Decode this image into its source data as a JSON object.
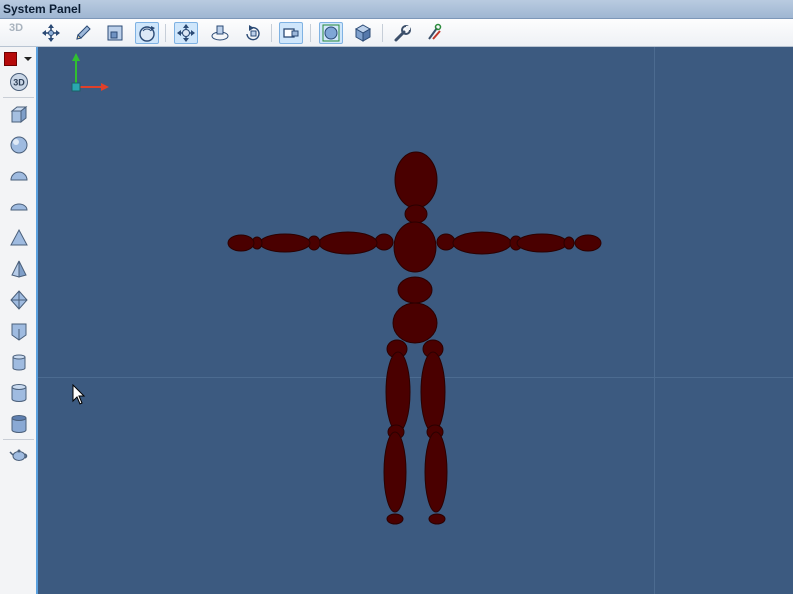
{
  "window": {
    "title": "System Panel"
  },
  "toolbar": {
    "mode_label": "3D",
    "tools": [
      {
        "icon": "move-icon"
      },
      {
        "icon": "pencil-icon"
      },
      {
        "icon": "select-box-icon"
      },
      {
        "icon": "rotate-view-icon",
        "active": true
      },
      {
        "icon": "pan-icon",
        "active": true
      },
      {
        "icon": "orbit-icon"
      },
      {
        "icon": "rotate-object-icon"
      },
      {
        "icon": "component-icon",
        "active": true
      },
      {
        "icon": "material-sphere-icon",
        "active": true
      },
      {
        "icon": "cube-icon"
      },
      {
        "icon": "wrench-icon"
      },
      {
        "icon": "tools-icon"
      }
    ]
  },
  "left_toolbar": {
    "color": "#b50a0a",
    "badge_label": "3D",
    "shapes": [
      "box",
      "sphere",
      "hemisphere",
      "ellipsoid",
      "cone",
      "pyramid",
      "octahedron",
      "prism",
      "cylinder",
      "tall-cylinder",
      "tube",
      "teapot"
    ]
  },
  "viewport": {
    "background": "#3c5a80",
    "figure_color": "#4a0000",
    "axis_x_color": "#e0402a",
    "axis_y_color": "#30c030"
  }
}
